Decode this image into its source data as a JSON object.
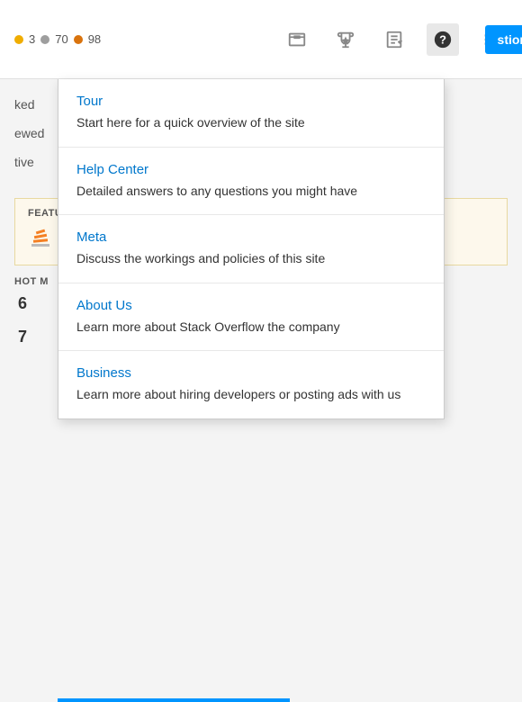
{
  "header": {
    "dots": [
      {
        "value": "3",
        "color": "dot-yellow"
      },
      {
        "value": "70",
        "color": "dot-gray"
      },
      {
        "value": "98",
        "color": "dot-orange"
      }
    ],
    "question_btn": "stion"
  },
  "background": {
    "featured_label": "FEATU",
    "hot_label": "HOT M",
    "number1": "6",
    "number2": "7",
    "side_text_1": "ked",
    "side_text_2": "ewed",
    "side_text_3": "tive"
  },
  "dropdown": {
    "items": [
      {
        "title": "Tour",
        "description": "Start here for a quick overview of the site"
      },
      {
        "title": "Help Center",
        "description": "Detailed answers to any questions you might have"
      },
      {
        "title": "Meta",
        "description": "Discuss the workings and policies of this site"
      },
      {
        "title": "About Us",
        "description": "Learn more about Stack Overflow the company"
      },
      {
        "title": "Business",
        "description": "Learn more about hiring developers or posting ads with us"
      }
    ]
  }
}
